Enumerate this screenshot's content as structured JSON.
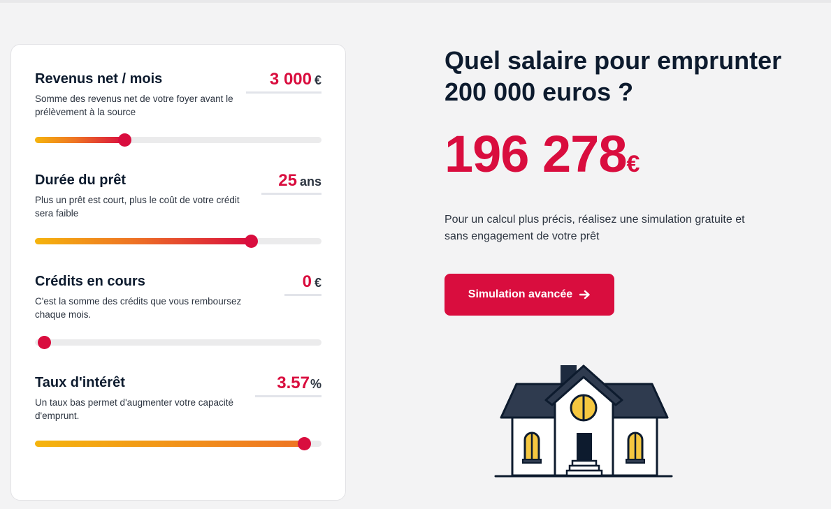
{
  "calculator": {
    "income": {
      "title": "Revenus net / mois",
      "description": "Somme des revenus net de votre foyer avant le prélèvement à la source",
      "value": "3 000",
      "unit": "€",
      "slider_fraction": 0.3
    },
    "duration": {
      "title": "Durée du prêt",
      "description": "Plus un prêt est court, plus le coût de votre crédit sera faible",
      "value": "25",
      "unit": "ans",
      "slider_fraction": 0.77
    },
    "credits": {
      "title": "Crédits en cours",
      "description": "C'est la somme des crédits que vous remboursez chaque mois.",
      "value": "0",
      "unit": "€",
      "slider_fraction": 0.0
    },
    "rate": {
      "title": "Taux d'intérêt",
      "description": "Un taux bas permet d'augmenter votre capacité d'emprunt.",
      "value": "3.57",
      "unit": "%",
      "slider_fraction": 0.97
    }
  },
  "result": {
    "headline": "Quel salaire pour emprunter 200 000 euros ?",
    "amount": "196 278",
    "currency": "€",
    "info": "Pour un calcul plus précis, réalisez une simulation gratuite et sans engagement de votre prêt",
    "cta_label": "Simulation avancée",
    "cta_icon": "arrow-right-icon",
    "illustration": "house-icon"
  },
  "colors": {
    "accent": "#d90d3e",
    "text_dark": "#0d1b2e",
    "gradient_start": "#f5b40d",
    "gradient_mid": "#ee7424",
    "track": "#ebebec",
    "background": "#f3f3f4"
  }
}
